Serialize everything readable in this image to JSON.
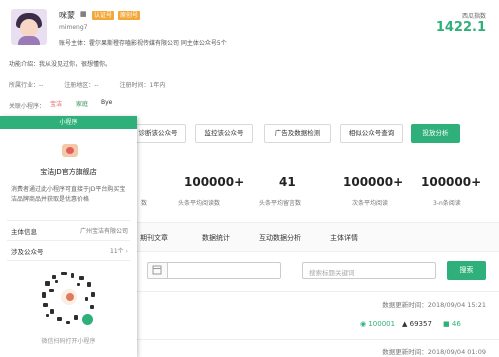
{
  "account": {
    "name": "咪蒙",
    "name_icon": "qr-icon",
    "badge_verified": "认证号",
    "badge_original": "原创号",
    "id": "mimeng7",
    "owner": "账号主体：霍尔果斯橙存嗑影视传媒有限公司 同主体公众号5个",
    "score_label": "西瓜指数",
    "score_value": "1422.1"
  },
  "intro": "功能介绍：我从没见过你，很想懂你。",
  "meta": {
    "region": "所属行业：--",
    "area": "注册地区：--",
    "founded": "注册时间：1年内"
  },
  "mini_programs": {
    "label": "关联小程序：",
    "items": [
      "宝洁",
      "家庭",
      "Bye"
    ]
  },
  "actions": [
    "诊断该公众号",
    "监控该公众号",
    "广告及数据检测",
    "相似公众号查询",
    "投放分析"
  ],
  "stats": [
    {
      "value": "100000+",
      "label": "头条平均阅读数"
    },
    {
      "value": "41",
      "label": "头条平均留言数"
    },
    {
      "value": "100000+",
      "label": "次条平均阅读"
    },
    {
      "value": "100000+",
      "label": "3-n条阅读"
    }
  ],
  "stats_left_label": "数",
  "tabs": [
    "期刊文章",
    "数据统计",
    "互动数据分析",
    "主体详情"
  ],
  "filter": {
    "search_placeholder": "搜索标题关键词",
    "search_button": "搜索"
  },
  "rows": [
    {
      "update": "数据更新时间：2018/09/04 15:21",
      "reads": "100001",
      "likes": "69357",
      "comments": "46"
    },
    {
      "update": "数据更新时间：2018/09/04 01:09"
    }
  ],
  "panel": {
    "header": "小程序",
    "title": "宝洁JD官方旗舰店",
    "description": "消费者通过此小程序可直接于JD平台购买宝洁品牌商品并获取是优惠价格",
    "subject_label": "主体信息",
    "subject_value": "广州宝洁有限公司",
    "related_label": "涉及公众号",
    "related_value": "11个",
    "scan_text": "微信扫码打开小程序"
  },
  "colors": {
    "accent": "#2fb07a",
    "badge": "#f3a83a"
  }
}
